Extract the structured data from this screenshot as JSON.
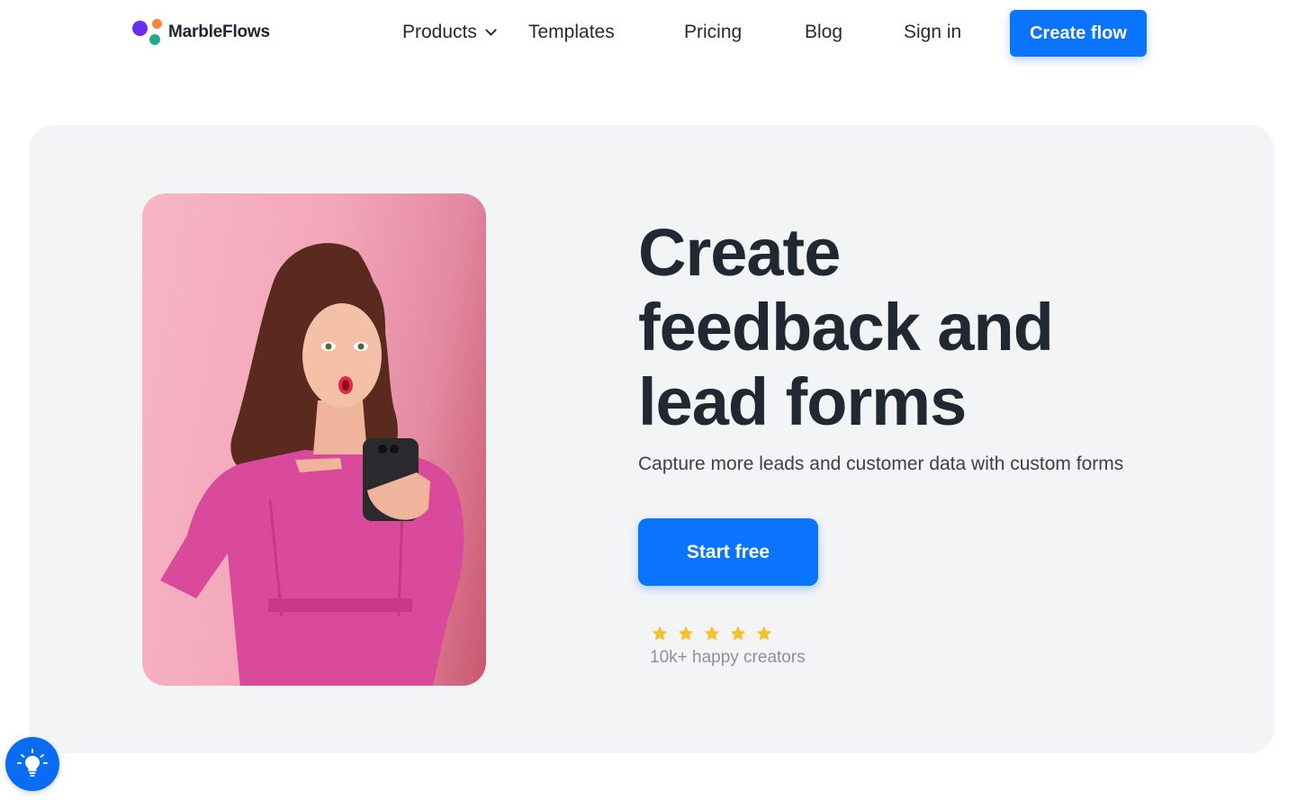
{
  "brand": {
    "name": "MarbleFlows",
    "colors": {
      "primary": "#0a74ff",
      "dot_purple": "#6a2cf0",
      "dot_orange": "#f7893b",
      "dot_teal": "#23a98e"
    }
  },
  "nav": {
    "products": "Products",
    "templates": "Templates",
    "pricing": "Pricing",
    "blog": "Blog",
    "signin": "Sign in",
    "cta": "Create flow"
  },
  "hero": {
    "headline": [
      "Create",
      "feedback and",
      "lead forms"
    ],
    "subtitle": "Capture more leads and customer data with custom forms",
    "cta": "Start free",
    "rating": {
      "stars": 5,
      "max": 5,
      "color": "#f7c02d",
      "text": "10k+ happy creators"
    },
    "image": "woman-pointing-at-phone-photo"
  },
  "fab": {
    "icon": "lightbulb-icon"
  }
}
